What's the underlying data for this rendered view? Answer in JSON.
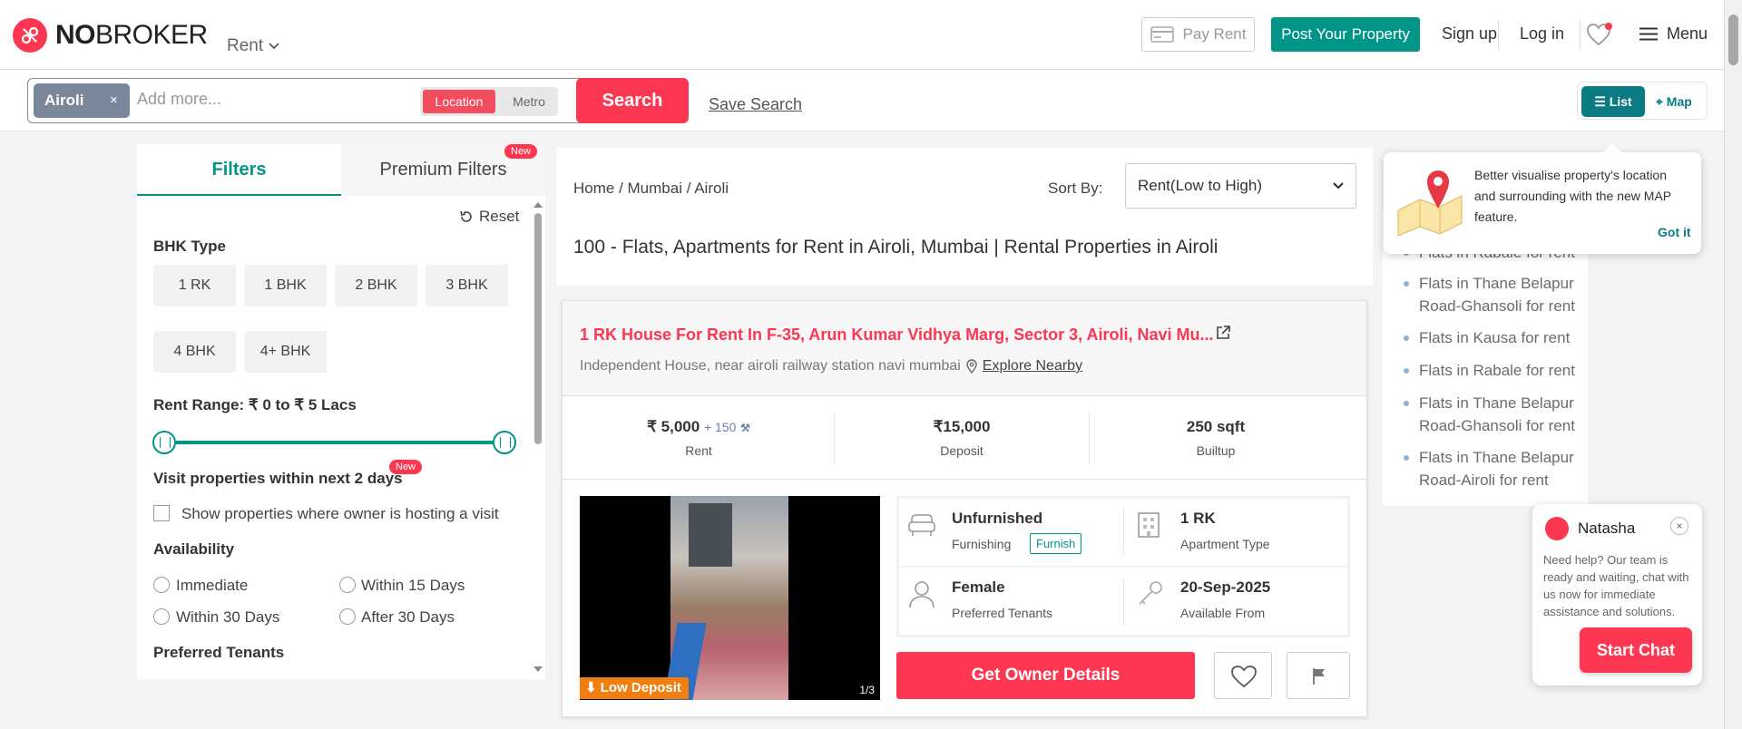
{
  "header": {
    "brand_no": "NO",
    "brand_broker": "BROKER",
    "rent_dropdown": "Rent",
    "pay_rent": "Pay Rent",
    "post_property": "Post Your Property",
    "signup": "Sign up",
    "login": "Log in",
    "menu": "Menu"
  },
  "search": {
    "chip": "Airoli",
    "chip_remove": "×",
    "placeholder": "Add more...",
    "toggle_location": "Location",
    "toggle_metro": "Metro",
    "button": "Search",
    "save": "Save Search"
  },
  "view_toggle": {
    "list": "List",
    "map": "Map"
  },
  "filters": {
    "tab_filters": "Filters",
    "tab_premium": "Premium Filters",
    "new_badge": "New",
    "reset": "Reset",
    "bhk_label": "BHK Type",
    "bhk_options": [
      "1 RK",
      "1 BHK",
      "2 BHK",
      "3 BHK",
      "4 BHK",
      "4+ BHK"
    ],
    "rent_range": "Rent Range: ₹ 0 to ₹ 5 Lacs",
    "visit_label": "Visit properties within next 2 days",
    "visit_checkbox": "Show properties where owner is hosting a visit",
    "availability_label": "Availability",
    "availability": [
      "Immediate",
      "Within 15 Days",
      "Within 30 Days",
      "After 30 Days"
    ],
    "preferred_label": "Preferred Tenants"
  },
  "listing_header": {
    "breadcrumb": "Home  / Mumbai / Airoli",
    "sort_label": "Sort By:",
    "sort_value": "Rent(Low to High)",
    "title": "100 - Flats, Apartments for Rent in Airoli, Mumbai | Rental Properties in Airoli"
  },
  "property": {
    "title": "1 RK House For Rent In F-35, Arun Kumar Vidhya Marg, Sector 3, Airoli, Navi Mu...",
    "subtitle": "Independent House, near airoli railway station navi mumbai",
    "explore": "Explore Nearby",
    "rent": "₹ 5,000",
    "rent_extra": "+ 150",
    "rent_label": "Rent",
    "deposit": "₹15,000",
    "deposit_label": "Deposit",
    "builtup": "250 sqft",
    "builtup_label": "Builtup",
    "badge": "Low Deposit",
    "photo_count": "1/3",
    "furnishing": "Unfurnished",
    "furnishing_label": "Furnishing",
    "furnish_tag": "Furnish",
    "apartment_type": "1 RK",
    "apartment_type_label": "Apartment Type",
    "tenants": "Female",
    "tenants_label": "Preferred Tenants",
    "available_from": "20-Sep-2025",
    "available_label": "Available From",
    "owner_button": "Get Owner Details"
  },
  "related_links": [
    "Flats in Rabale for rent",
    "Flats in Thane Belapur Road-Ghansoli for rent",
    "Flats in Kausa for rent",
    "Flats in Rabale for rent",
    "Flats in Thane Belapur Road-Ghansoli for rent",
    "Flats in Thane Belapur Road-Airoli for rent"
  ],
  "map_tip": {
    "text": "Better visualise property's location and surrounding with the new MAP feature.",
    "action": "Got it"
  },
  "chat": {
    "name": "Natasha",
    "close": "×",
    "message": "Need help? Our team is ready and waiting, chat with us now for immediate assistance and solutions.",
    "button": "Start Chat"
  },
  "colors": {
    "brand": "#fd3752",
    "teal": "#009587",
    "dark_teal": "#0a7b83"
  }
}
